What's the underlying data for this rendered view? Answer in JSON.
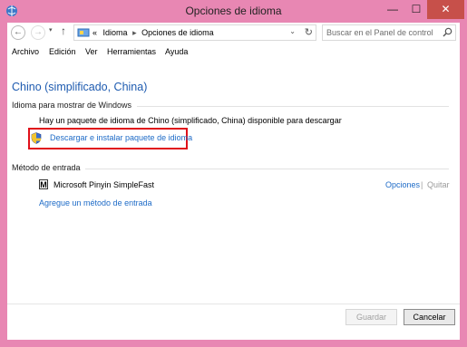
{
  "window": {
    "title": "Opciones de idioma",
    "minimize_glyph": "—",
    "maximize_glyph": "☐",
    "close_glyph": "✕",
    "accent_color": "#e887b3",
    "close_color": "#c7504a"
  },
  "nav": {
    "back_glyph": "←",
    "forward_glyph": "→",
    "recent_glyph": "▾",
    "up_glyph": "↑",
    "breadcrumb": {
      "prefix": "«",
      "items": [
        "Idioma",
        "Opciones de idioma"
      ],
      "separator": "▸"
    },
    "dropdown_glyph": "⌄",
    "refresh_glyph": "↻",
    "search_placeholder": "Buscar en el Panel de control"
  },
  "menu": {
    "items": [
      "Archivo",
      "Edición",
      "Ver",
      "Herramientas",
      "Ayuda"
    ]
  },
  "main": {
    "heading": "Chino (simplificado, China)",
    "display_section": {
      "label": "Idioma para mostrar de Windows",
      "message": "Hay un paquete de idioma de Chino (simplificado, China) disponible para descargar",
      "download_link": "Descargar e instalar paquete de idioma"
    },
    "input_section": {
      "label": "Método de entrada",
      "method_icon_letter": "M",
      "method_name": "Microsoft Pinyin SimpleFast",
      "options_link": "Opciones",
      "separator": "|",
      "remove_link": "Quitar",
      "add_link": "Agregue un método de entrada"
    }
  },
  "footer": {
    "save_label": "Guardar",
    "cancel_label": "Cancelar"
  },
  "colors": {
    "link": "#1e6bc7",
    "heading": "#1e5bb0",
    "highlight_box": "#e0101a"
  }
}
